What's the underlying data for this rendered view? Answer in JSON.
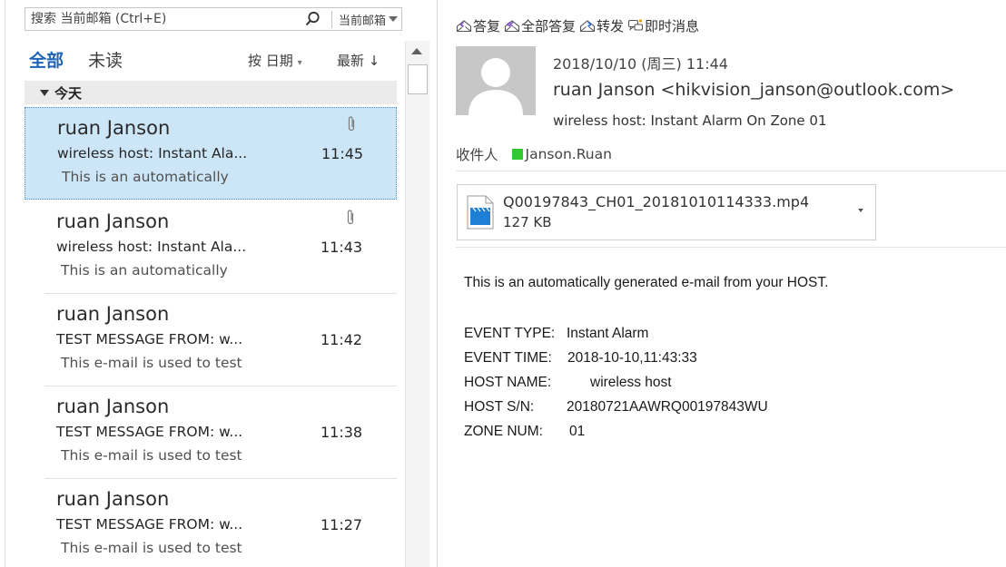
{
  "search": {
    "placeholder": "搜索 当前邮箱 (Ctrl+E)",
    "scope": "当前邮箱"
  },
  "filters": {
    "all": "全部",
    "unread": "未读",
    "sort_by": "按 日期",
    "sort_order": "最新 ↓"
  },
  "group": {
    "label": "今天"
  },
  "mails": [
    {
      "sender": "ruan Janson",
      "subject": "wireless host: Instant Ala...",
      "time": "11:45",
      "preview": "This is an automatically",
      "attachment": true,
      "selected": true
    },
    {
      "sender": "ruan Janson",
      "subject": "wireless host: Instant Ala...",
      "time": "11:43",
      "preview": "This is an automatically",
      "attachment": true,
      "selected": false
    },
    {
      "sender": "ruan Janson",
      "subject": "TEST MESSAGE FROM: w...",
      "time": "11:42",
      "preview": "This e-mail is used to test",
      "attachment": false,
      "selected": false
    },
    {
      "sender": "ruan Janson",
      "subject": "TEST MESSAGE FROM: w...",
      "time": "11:38",
      "preview": "This e-mail is used to test",
      "attachment": false,
      "selected": false
    },
    {
      "sender": "ruan Janson",
      "subject": "TEST MESSAGE FROM: w...",
      "time": "11:27",
      "preview": "This e-mail is used to test",
      "attachment": false,
      "selected": false
    }
  ],
  "actions": {
    "reply": "答复",
    "reply_all": "全部答复",
    "forward": "转发",
    "im": "即时消息"
  },
  "message": {
    "date": "2018/10/10 (周三) 11:44",
    "from": "ruan Janson <hikvision_janson@outlook.com>",
    "subject": "wireless host: Instant Alarm On Zone 01",
    "to_label": "收件人",
    "to_name": "Janson.Ruan",
    "attachment": {
      "name": "Q00197843_CH01_20181010114333.mp4",
      "size": "127 KB"
    },
    "body": {
      "intro": "This is an automatically generated e-mail from your HOST.",
      "fields": [
        {
          "label": "EVENT TYPE:",
          "value": "Instant Alarm"
        },
        {
          "label": "EVENT TIME:",
          "value": "2018-10-10,11:43:33"
        },
        {
          "label": "HOST NAME:",
          "value": "wireless host"
        },
        {
          "label": "HOST S/N:",
          "value": "20180721AAWRQ00197843WU"
        },
        {
          "label": "ZONE NUM:",
          "value": "01"
        }
      ]
    }
  },
  "colors": {
    "accent": "#1e64b4",
    "selected_row": "#cde6f7",
    "presence_available": "#32c832",
    "video_file": "#1e7fd6"
  }
}
